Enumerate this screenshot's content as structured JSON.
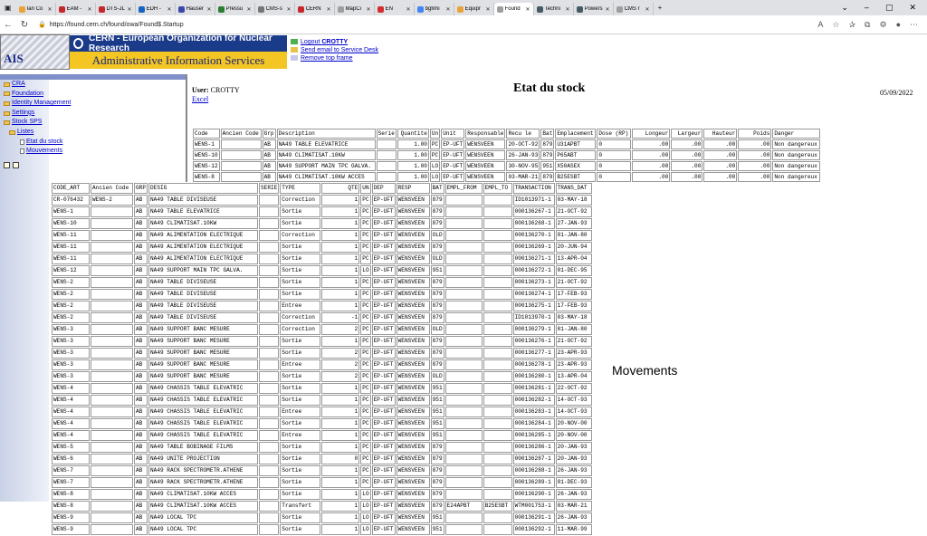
{
  "browser": {
    "tabs": [
      {
        "label": "Ian Co",
        "color": "#e8a33a"
      },
      {
        "label": "EAM -",
        "color": "#c62828"
      },
      {
        "label": "DTS-JL",
        "color": "#c62828"
      },
      {
        "label": "EDH -",
        "color": "#1565c0"
      },
      {
        "label": "Hauser",
        "color": "#3949ab"
      },
      {
        "label": "Pressu",
        "color": "#2e7d32"
      },
      {
        "label": "CMS-s",
        "color": "#757575"
      },
      {
        "label": "CERN",
        "color": "#c62828"
      },
      {
        "label": "MapCi",
        "color": "#9e9e9e"
      },
      {
        "label": "EN",
        "color": "#d32f2f"
      },
      {
        "label": "bgfimi",
        "color": "#4285f4"
      },
      {
        "label": "Equipr",
        "color": "#e8a33a"
      },
      {
        "label": "Found",
        "color": "#9e9e9e",
        "active": true
      },
      {
        "label": "Techni",
        "color": "#455a64"
      },
      {
        "label": "Powers",
        "color": "#455a64"
      },
      {
        "label": "CMS r",
        "color": "#9e9e9e"
      }
    ],
    "url": "https://found.cern.ch/found/owa/Found$.Startup"
  },
  "banner": {
    "cern": "CERN - European Organization for Nuclear Research",
    "ais": "Administrative Information Services",
    "logo": "AIS",
    "logout_prefix": "Logout ",
    "logout_user": "CROTTY",
    "service_desk": "Send email to Service Desk",
    "remove_frame": "Remove top frame"
  },
  "tree": {
    "cra": "CRA",
    "foundation": "Foundation",
    "identity": "Identity Management",
    "settings": "Settings",
    "stock": "Stock SPS",
    "listes": "Listes",
    "etat": "Etat du stock",
    "mouvements": "Mouvements"
  },
  "header": {
    "user_label": "User:",
    "user": "CROTTY",
    "excel": "Excel",
    "title": "Etat du stock",
    "date": "05/09/2022"
  },
  "stock": {
    "columns": [
      "Code",
      "Ancien Code",
      "Grp",
      "Description",
      "Serie",
      "Quantite",
      "Un",
      "Unit",
      "Responsable",
      "Recu le",
      "Bat",
      "Emplacement",
      "Dose (RP)",
      "Longeur",
      "Largeur",
      "Hauteur",
      "Poids",
      "Danger"
    ],
    "rows": [
      [
        "WENS-1",
        "",
        "AB",
        "NA49 TABLE ELEVATRICE",
        "",
        "1.00",
        "PC",
        "EP-UFT",
        "WENSVEEN",
        "20-OCT-92",
        "879",
        "U31APBT",
        "0",
        ".00",
        ".00",
        ".00",
        ".00",
        "Non dangereux"
      ],
      [
        "WENS-10",
        "",
        "AB",
        "NA49 CLIMATISAT.10KW",
        "",
        "1.00",
        "PC",
        "EP-UFT",
        "WENSVEEN",
        "26-JAN-93",
        "879",
        "P65ABT",
        "0",
        ".00",
        ".00",
        ".00",
        ".00",
        "Non dangereux"
      ],
      [
        "WENS-12",
        "",
        "AB",
        "NA49 SUPPORT MAIN TPC GALVA.",
        "",
        "1.00",
        "LO",
        "EP-UFT",
        "WENSVEEN",
        "30-NOV-95",
        "951",
        "X50ASEX",
        "0",
        ".00",
        ".00",
        ".00",
        ".00",
        "Non dangereux"
      ],
      [
        "WENS-8",
        "",
        "AB",
        "NA49 CLIMATISAT.10KW ACCES",
        "",
        "1.00",
        "LO",
        "EP-UFT",
        "WENSVEEN",
        "03-MAR-21",
        "879",
        "B25ESBT",
        "0",
        ".00",
        ".00",
        ".00",
        ".00",
        "Non dangereux"
      ]
    ]
  },
  "movements": {
    "label": "Movements",
    "columns": [
      "CODE_ART",
      "Ancien Code",
      "GRP",
      "DESIG",
      "SERIE",
      "TYPE",
      "QTE",
      "UN",
      "DEP",
      "RESP",
      "BAT",
      "EMPL_FROM",
      "EMPL_TO",
      "TRANSACTION",
      "TRANS_DAT"
    ],
    "rows": [
      [
        "CR-076432",
        "WENS-2",
        "AB",
        "NA49 TABLE DIVISEUSE",
        "",
        "Correction",
        "1",
        "PC",
        "EP-UFT",
        "WENSVEEN",
        "879",
        "",
        "",
        "ID1013971-1",
        "03-MAY-18"
      ],
      [
        "WENS-1",
        "",
        "AB",
        "NA49 TABLE ELEVATRICE",
        "",
        "Sortie",
        "1",
        "PC",
        "EP-UFT",
        "WENSVEEN",
        "879",
        "",
        "",
        "000136267-1",
        "21-OCT-92"
      ],
      [
        "WENS-10",
        "",
        "AB",
        "NA49 CLIMATISAT.10KW",
        "",
        "Sortie",
        "1",
        "PC",
        "EP-UFT",
        "WENSVEEN",
        "879",
        "",
        "",
        "000136268-1",
        "27-JAN-93"
      ],
      [
        "WENS-11",
        "",
        "AB",
        "NA49 ALIMENTATION ELECTRIQUE",
        "",
        "Correction",
        "1",
        "PC",
        "EP-UFT",
        "WENSVEEN",
        "OLD",
        "",
        "",
        "000136270-1",
        "01-JAN-80"
      ],
      [
        "WENS-11",
        "",
        "AB",
        "NA49 ALIMENTATION ELECTRIQUE",
        "",
        "Sortie",
        "1",
        "PC",
        "EP-UFT",
        "WENSVEEN",
        "879",
        "",
        "",
        "000136269-1",
        "20-JUN-94"
      ],
      [
        "WENS-11",
        "",
        "AB",
        "NA49 ALIMENTATION ELECTRIQUE",
        "",
        "Sortie",
        "1",
        "PC",
        "EP-UFT",
        "WENSVEEN",
        "OLD",
        "",
        "",
        "000136271-1",
        "13-APR-04"
      ],
      [
        "WENS-12",
        "",
        "AB",
        "NA49 SUPPORT MAIN TPC GALVA.",
        "",
        "Sortie",
        "1",
        "LO",
        "EP-UFT",
        "WENSVEEN",
        "951",
        "",
        "",
        "000136272-1",
        "01-DEC-95"
      ],
      [
        "WENS-2",
        "",
        "AB",
        "NA49 TABLE DIVISEUSE",
        "",
        "Sortie",
        "1",
        "PC",
        "EP-UFT",
        "WENSVEEN",
        "879",
        "",
        "",
        "000136273-1",
        "21-OCT-92"
      ],
      [
        "WENS-2",
        "",
        "AB",
        "NA49 TABLE DIVISEUSE",
        "",
        "Sortie",
        "1",
        "PC",
        "EP-UFT",
        "WENSVEEN",
        "879",
        "",
        "",
        "000136274-1",
        "17-FEB-93"
      ],
      [
        "WENS-2",
        "",
        "AB",
        "NA49 TABLE DIVISEUSE",
        "",
        "Entree",
        "1",
        "PC",
        "EP-UFT",
        "WENSVEEN",
        "879",
        "",
        "",
        "000136275-1",
        "17-FEB-93"
      ],
      [
        "WENS-2",
        "",
        "AB",
        "NA49 TABLE DIVISEUSE",
        "",
        "Correction",
        "-1",
        "PC",
        "EP-UFT",
        "WENSVEEN",
        "879",
        "",
        "",
        "ID1013970-1",
        "03-MAY-18"
      ],
      [
        "WENS-3",
        "",
        "AB",
        "NA49 SUPPORT BANC MESURE",
        "",
        "Correction",
        "2",
        "PC",
        "EP-UFT",
        "WENSVEEN",
        "OLD",
        "",
        "",
        "000136279-1",
        "01-JAN-80"
      ],
      [
        "WENS-3",
        "",
        "AB",
        "NA49 SUPPORT BANC MESURE",
        "",
        "Sortie",
        "1",
        "PC",
        "EP-UFT",
        "WENSVEEN",
        "879",
        "",
        "",
        "000136276-1",
        "21-OCT-92"
      ],
      [
        "WENS-3",
        "",
        "AB",
        "NA49 SUPPORT BANC MESURE",
        "",
        "Sortie",
        "2",
        "PC",
        "EP-UFT",
        "WENSVEEN",
        "879",
        "",
        "",
        "000136277-1",
        "23-APR-93"
      ],
      [
        "WENS-3",
        "",
        "AB",
        "NA49 SUPPORT BANC MESURE",
        "",
        "Entree",
        "2",
        "PC",
        "EP-UFT",
        "WENSVEEN",
        "879",
        "",
        "",
        "000136278-1",
        "23-APR-93"
      ],
      [
        "WENS-3",
        "",
        "AB",
        "NA49 SUPPORT BANC MESURE",
        "",
        "Sortie",
        "2",
        "PC",
        "EP-UFT",
        "WENSVEEN",
        "OLD",
        "",
        "",
        "000136280-1",
        "13-APR-04"
      ],
      [
        "WENS-4",
        "",
        "AB",
        "NA49 CHASSIS TABLE ELEVATRIC",
        "",
        "Sortie",
        "1",
        "PC",
        "EP-UFT",
        "WENSVEEN",
        "951",
        "",
        "",
        "000136281-1",
        "22-OCT-92"
      ],
      [
        "WENS-4",
        "",
        "AB",
        "NA49 CHASSIS TABLE ELEVATRIC",
        "",
        "Sortie",
        "1",
        "PC",
        "EP-UFT",
        "WENSVEEN",
        "951",
        "",
        "",
        "000136282-1",
        "14-OCT-93"
      ],
      [
        "WENS-4",
        "",
        "AB",
        "NA49 CHASSIS TABLE ELEVATRIC",
        "",
        "Entree",
        "1",
        "PC",
        "EP-UFT",
        "WENSVEEN",
        "951",
        "",
        "",
        "000136283-1",
        "14-OCT-93"
      ],
      [
        "WENS-4",
        "",
        "AB",
        "NA49 CHASSIS TABLE ELEVATRIC",
        "",
        "Sortie",
        "1",
        "PC",
        "EP-UFT",
        "WENSVEEN",
        "951",
        "",
        "",
        "000136284-1",
        "20-NOV-00"
      ],
      [
        "WENS-4",
        "",
        "AB",
        "NA49 CHASSIS TABLE ELEVATRIC",
        "",
        "Entree",
        "1",
        "PC",
        "EP-UFT",
        "WENSVEEN",
        "951",
        "",
        "",
        "000136285-1",
        "20-NOV-00"
      ],
      [
        "WENS-5",
        "",
        "AB",
        "NA49 TABLE BOBINAGE FILMS",
        "",
        "Sortie",
        "1",
        "PC",
        "EP-UFT",
        "WENSVEEN",
        "879",
        "",
        "",
        "000136286-1",
        "20-JAN-93"
      ],
      [
        "WENS-6",
        "",
        "AB",
        "NA49 UNITE PROJECTION",
        "",
        "Sortie",
        "0",
        "PC",
        "EP-UFT",
        "WENSVEEN",
        "879",
        "",
        "",
        "000136287-1",
        "20-JAN-93"
      ],
      [
        "WENS-7",
        "",
        "AB",
        "NA49 RACK SPECTROMETR.ATHENE",
        "",
        "Sortie",
        "1",
        "PC",
        "EP-UFT",
        "WENSVEEN",
        "879",
        "",
        "",
        "000136288-1",
        "26-JAN-93"
      ],
      [
        "WENS-7",
        "",
        "AB",
        "NA49 RACK SPECTROMETR.ATHENE",
        "",
        "Sortie",
        "1",
        "PC",
        "EP-UFT",
        "WENSVEEN",
        "879",
        "",
        "",
        "000136289-1",
        "01-DEC-93"
      ],
      [
        "WENS-8",
        "",
        "AB",
        "NA49 CLIMATISAT.10KW ACCES",
        "",
        "Sortie",
        "1",
        "LO",
        "EP-UFT",
        "WENSVEEN",
        "879",
        "",
        "",
        "000136290-1",
        "26-JAN-93"
      ],
      [
        "WENS-8",
        "",
        "AB",
        "NA49 CLIMATISAT.10KW ACCES",
        "",
        "Transfert",
        "1",
        "LO",
        "EP-UFT",
        "WENSVEEN",
        "879",
        "E24APBT",
        "B25ESBT",
        "WTM001753-1",
        "03-MAR-21"
      ],
      [
        "WENS-9",
        "",
        "AB",
        "NA49 LOCAL TPC",
        "",
        "Sortie",
        "1",
        "LO",
        "EP-UFT",
        "WENSVEEN",
        "951",
        "",
        "",
        "000136291-1",
        "26-JAN-93"
      ],
      [
        "WENS-9",
        "",
        "AB",
        "NA49 LOCAL TPC",
        "",
        "Sortie",
        "1",
        "LO",
        "EP-UFT",
        "WENSVEEN",
        "951",
        "",
        "",
        "000136292-1",
        "11-MAR-99"
      ]
    ]
  }
}
